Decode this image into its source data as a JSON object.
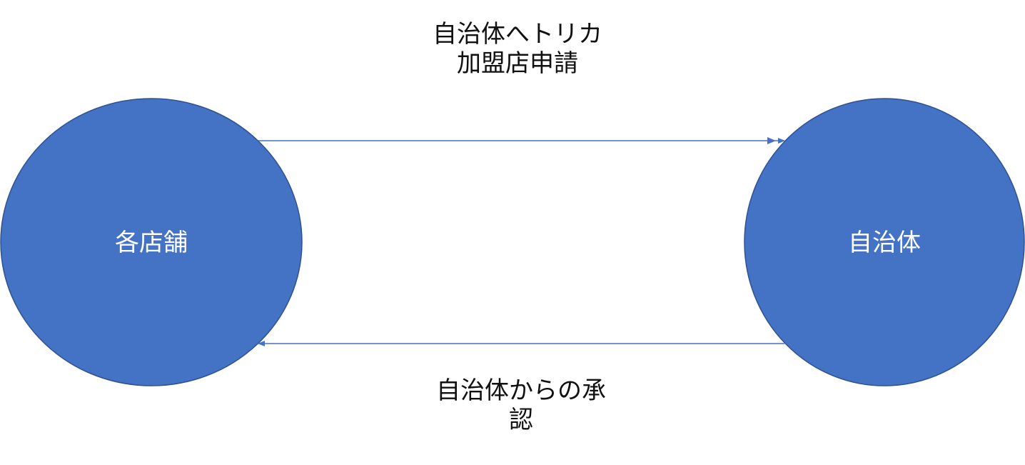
{
  "nodes": {
    "stores": {
      "label": "各店舗"
    },
    "municipality": {
      "label": "自治体"
    }
  },
  "edges": {
    "application": {
      "label": "自治体へトリカ\n加盟店申請"
    },
    "approval": {
      "label": "自治体からの承\n認"
    }
  },
  "colors": {
    "node_fill": "#4472C4",
    "node_stroke": "#2F528F",
    "arrow": "#4472C4"
  }
}
